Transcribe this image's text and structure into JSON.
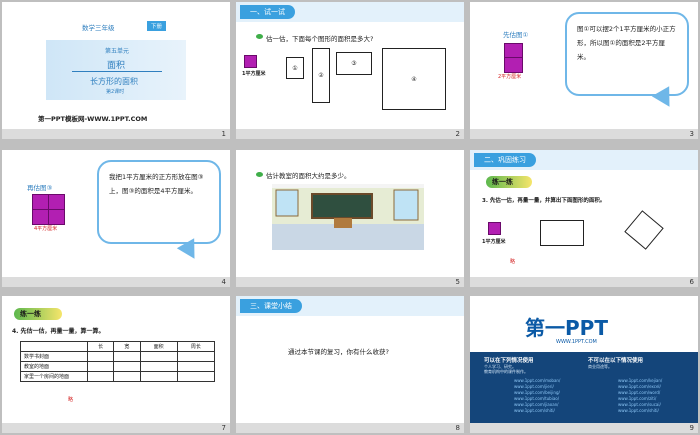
{
  "slides": {
    "s1": {
      "grade": "数学三年级",
      "volume": "下册",
      "unit": "第五单元",
      "topic": "面积",
      "lesson": "长方形的面积",
      "period": "第2课时",
      "site": "第一PPT模板网-WWW.1PPT.COM",
      "num": "1"
    },
    "s2": {
      "section": "一、试一试",
      "question": "估一估，下面每个图形的面积是多大?",
      "unit_label": "1平方厘米",
      "shape1": "①",
      "shape2": "②",
      "shape3": "③",
      "shape4": "④",
      "num": "2"
    },
    "s3": {
      "heading": "先估图①",
      "caption": "2平方厘米",
      "bubble": "图①可以摆2个1平方厘米的小正方形，所以图①的面积是2平方厘米。",
      "num": "3"
    },
    "s4": {
      "heading": "再估图③",
      "caption": "4平方厘米",
      "bubble": "我把1平方厘米的正方形放在图③上，图③的面积是4平方厘米。",
      "num": "4"
    },
    "s5": {
      "question": "估计教室的面积大约是多少。",
      "num": "5"
    },
    "s6": {
      "section": "二、巩固练习",
      "tag": "练一练",
      "question": "3. 先估一估，再量一量，并算出下面图形的面积。",
      "unit_label": "1平方厘米",
      "note": "略",
      "num": "6"
    },
    "s7": {
      "tag": "练一练",
      "question": "4. 先估一估，再量一量，算一算。",
      "headers": [
        "",
        "长",
        "宽",
        "面积",
        "周长"
      ],
      "rows": [
        "数学书封面",
        "教室的地面",
        "家里一个房间的地面"
      ],
      "note": "略",
      "num": "7"
    },
    "s8": {
      "section": "三、课堂小结",
      "question": "通过本节课的复习，你有什么收获?",
      "num": "8"
    },
    "s9": {
      "logo": "第一PPT",
      "url": "WWW.1PPT.COM",
      "can_title": "可以在下列情况使用",
      "can_items": [
        "个人学习、研究。",
        "教育机构中的课件制作。"
      ],
      "cannot_title": "不可以在以下情况使用",
      "cannot_items": [
        "商业用途等。"
      ],
      "links_left": [
        "www.1ppt.com/moban/",
        "www.1ppt.com/jieri/",
        "www.1ppt.com/beijing/",
        "www.1ppt.com/tubiao/",
        "www.1ppt.com/jiaoan/",
        "www.1ppt.com/shiti/"
      ],
      "links_right": [
        "www.1ppt.com/kejian/",
        "www.1ppt.com/excel/",
        "www.1ppt.com/word/",
        "www.1ppt.com/ziti/",
        "www.1ppt.com/sucai/",
        "www.1ppt.com/shiti/"
      ],
      "num": "9"
    }
  }
}
